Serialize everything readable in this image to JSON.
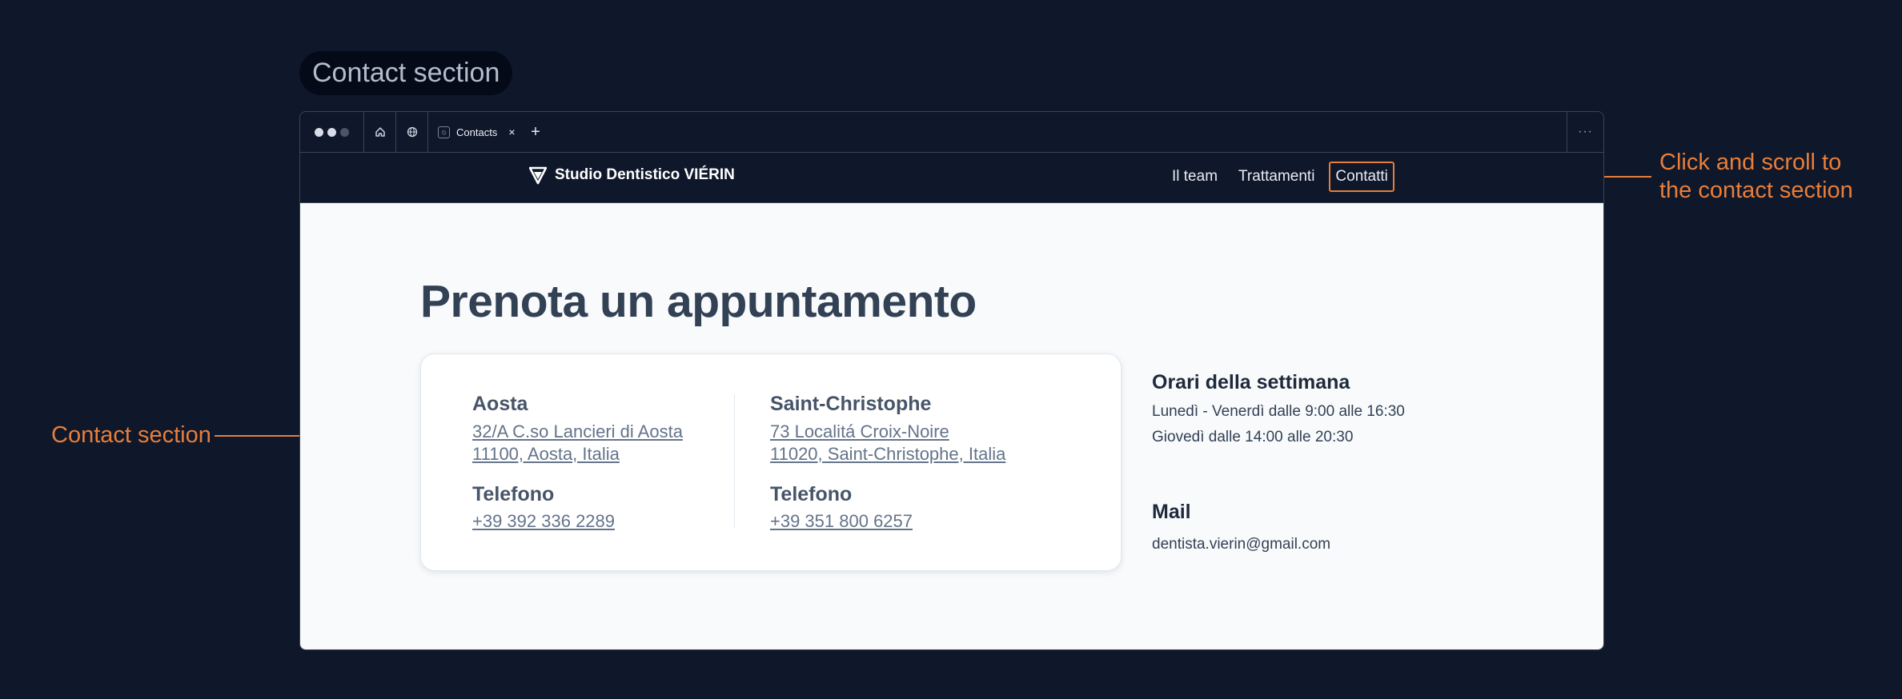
{
  "section_label": "Contact section",
  "annotations": {
    "left": "Contact section",
    "right_line1": "Click and scroll to",
    "right_line2": "the contact section"
  },
  "browser": {
    "tab_title": "Contacts",
    "tab_close": "×",
    "new_tab": "+",
    "more": "···"
  },
  "navbar": {
    "brand": "Studio Dentistico VIÉRIN",
    "links": [
      "Il team",
      "Trattamenti",
      "Contatti"
    ],
    "active_link": "Contatti"
  },
  "contact": {
    "heading": "Prenota un appuntamento",
    "locations": [
      {
        "city": "Aosta",
        "address_line1": "32/A  C.so Lancieri di Aosta",
        "address_line2": "11100, Aosta, Italia",
        "phone_label": "Telefono",
        "phone": "+39 392 336 2289"
      },
      {
        "city": "Saint-Christophe",
        "address_line1": "73  Localitá Croix-Noire",
        "address_line2": "11020, Saint-Christophe, Italia",
        "phone_label": "Telefono",
        "phone": "+39 351 800 6257"
      }
    ],
    "hours": {
      "title": "Orari della settimana",
      "line1": "Lunedì - Venerdì dalle 9:00 alle 16:30",
      "line2": "Giovedì dalle 14:00 alle 20:30"
    },
    "mail": {
      "title": "Mail",
      "address": "dentista.vierin@gmail.com"
    }
  },
  "colors": {
    "background": "#0f172a",
    "accent": "#e87e3a",
    "content_bg": "#f8fafc",
    "heading": "#334155"
  }
}
